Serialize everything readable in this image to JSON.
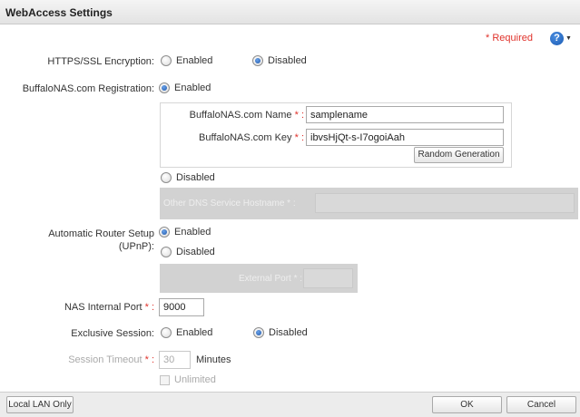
{
  "window": {
    "title": "WebAccess Settings"
  },
  "required_label": "* Required",
  "https": {
    "label": "HTTPS/SSL Encryption:",
    "opt_enabled": "Enabled",
    "opt_disabled": "Disabled",
    "selected": "Disabled"
  },
  "registration": {
    "label": "BuffaloNAS.com Registration:",
    "opt_enabled": "Enabled",
    "opt_disabled": "Disabled",
    "selected": "Enabled",
    "name_label": "BuffaloNAS.com Name",
    "name_value": "samplename",
    "key_label": "BuffaloNAS.com Key",
    "key_value": "ibvsHjQt-s-I7ogoiAah",
    "random_button": "Random Generation",
    "other_dns_label": "Other DNS Service Hostname * :"
  },
  "router": {
    "label_line1": "Automatic Router Setup",
    "label_line2": "(UPnP):",
    "opt_enabled": "Enabled",
    "opt_disabled": "Disabled",
    "selected": "Enabled",
    "external_port_label": "External Port * :"
  },
  "internal_port": {
    "label": "NAS Internal Port",
    "value": "9000"
  },
  "exclusive": {
    "label": "Exclusive Session:",
    "opt_enabled": "Enabled",
    "opt_disabled": "Disabled",
    "selected": "Disabled"
  },
  "session_timeout": {
    "label": "Session Timeout",
    "value": "30",
    "unit": "Minutes",
    "unlimited": "Unlimited"
  },
  "footer": {
    "local_lan_button": "Local LAN Only",
    "ok_button": "OK",
    "cancel_button": "Cancel"
  },
  "star_colon": " * :",
  "colors": {
    "required": "#e0322b",
    "accent": "#1f56a8"
  },
  "icons": {
    "help": "help-icon",
    "radio": "radio-icon"
  }
}
